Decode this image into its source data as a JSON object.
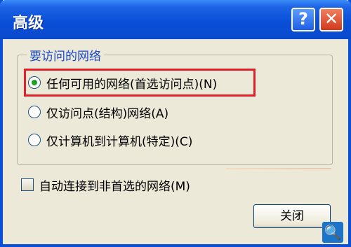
{
  "window": {
    "title": "高级",
    "help_button": "?",
    "close_button": "✕"
  },
  "group": {
    "legend": "要访问的网络",
    "options": [
      {
        "label": "任何可用的网络(首选访问点)(N)",
        "selected": true
      },
      {
        "label": "仅访问点(结构)网络(A)",
        "selected": false
      },
      {
        "label": "仅计算机到计算机(特定)(C)",
        "selected": false
      }
    ]
  },
  "auto_connect": {
    "label": "自动连接到非首选的网络(M)",
    "checked": false
  },
  "footer": {
    "close_label": "关闭",
    "magnify_icon": "🔍"
  }
}
